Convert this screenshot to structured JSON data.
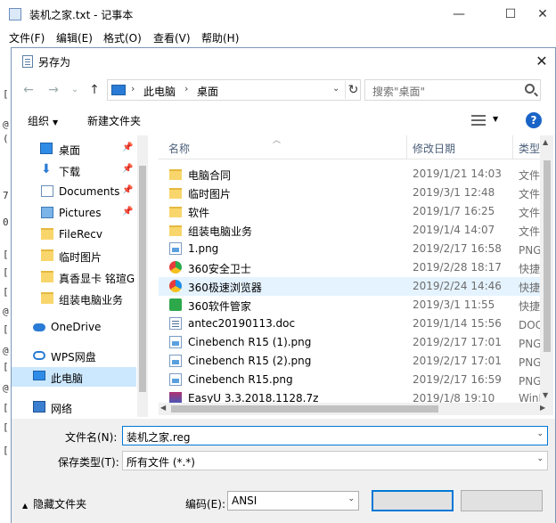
{
  "notepad": {
    "title": "装机之家.txt - 记事本",
    "controls": [
      "—",
      "☐",
      "✕"
    ],
    "menu": [
      "文件(F)",
      "编辑(E)",
      "格式(O)",
      "查看(V)",
      "帮助(H)"
    ],
    "gutter": [
      "[",
      "@",
      "(",
      "7",
      "0",
      "[",
      "[",
      "[",
      "@",
      "[",
      "@",
      "[",
      "@",
      "[",
      "[",
      "["
    ]
  },
  "dialog": {
    "title": "另存为",
    "close": "✕",
    "nav": {
      "back": "←",
      "forward": "→",
      "dropdown": "⌄",
      "up": "↑"
    },
    "address": {
      "parts": [
        "此电脑",
        "桌面"
      ],
      "separator": "›",
      "refresh": "↻"
    },
    "search": {
      "placeholder": "搜索\"桌面\""
    },
    "toolbar": {
      "organize": "组织",
      "new_folder": "新建文件夹",
      "help": "?"
    },
    "nav_pane": [
      {
        "label": "桌面",
        "icon": "desktop-icon",
        "pinned": true
      },
      {
        "label": "下载",
        "icon": "download-icon",
        "pinned": true
      },
      {
        "label": "Documents",
        "icon": "documents-icon",
        "pinned": true
      },
      {
        "label": "Pictures",
        "icon": "pictures-icon",
        "pinned": true
      },
      {
        "label": "FileRecv",
        "icon": "folder-icon",
        "pinned": false
      },
      {
        "label": "临时图片",
        "icon": "folder-icon",
        "pinned": false
      },
      {
        "label": "真香显卡 铭瑄G",
        "icon": "folder-icon",
        "pinned": false
      },
      {
        "label": "组装电脑业务",
        "icon": "folder-icon",
        "pinned": false
      },
      {
        "label": "OneDrive",
        "icon": "onedrive-icon",
        "pinned": false
      },
      {
        "label": "WPS网盘",
        "icon": "wps-cloud-icon",
        "pinned": false
      },
      {
        "label": "此电脑",
        "icon": "this-pc-icon",
        "pinned": false,
        "selected": true
      },
      {
        "label": "网络",
        "icon": "network-icon",
        "pinned": false
      }
    ],
    "columns": {
      "name": "名称",
      "date": "修改日期",
      "type": "类型"
    },
    "files": [
      {
        "name": "电脑合同",
        "date": "2019/1/21 14:03",
        "type": "文件夹",
        "icon": "folder-icon"
      },
      {
        "name": "临时图片",
        "date": "2019/3/1 12:48",
        "type": "文件夹",
        "icon": "folder-icon"
      },
      {
        "name": "软件",
        "date": "2019/1/7 16:25",
        "type": "文件夹",
        "icon": "folder-icon"
      },
      {
        "name": "组装电脑业务",
        "date": "2019/1/4 14:07",
        "type": "文件夹",
        "icon": "folder-icon"
      },
      {
        "name": "1.png",
        "date": "2019/2/17 16:58",
        "type": "PNG 文",
        "icon": "png-icon"
      },
      {
        "name": "360安全卫士",
        "date": "2019/2/28 18:17",
        "type": "快捷方",
        "icon": "360-safe-icon"
      },
      {
        "name": "360极速浏览器",
        "date": "2019/2/24 14:46",
        "type": "快捷方",
        "icon": "360-browser-icon"
      },
      {
        "name": "360软件管家",
        "date": "2019/3/1 11:55",
        "type": "快捷方",
        "icon": "360-manager-icon"
      },
      {
        "name": "antec20190113.doc",
        "date": "2019/1/14 15:56",
        "type": "DOC 文",
        "icon": "doc-icon"
      },
      {
        "name": "Cinebench R15 (1).png",
        "date": "2019/2/17 17:01",
        "type": "PNG 文",
        "icon": "png-icon"
      },
      {
        "name": "Cinebench R15 (2).png",
        "date": "2019/2/17 17:01",
        "type": "PNG 文",
        "icon": "png-icon"
      },
      {
        "name": "Cinebench R15.png",
        "date": "2019/2/17 16:59",
        "type": "PNG 文",
        "icon": "png-icon"
      },
      {
        "name": "EasyU 3.3.2018.1128.7z",
        "date": "2019/1/8 19:10",
        "type": "WinRA",
        "icon": "archive-icon"
      }
    ],
    "filename": {
      "label": "文件名(N):",
      "value": "装机之家.reg"
    },
    "filetype": {
      "label": "保存类型(T):",
      "value": "所有文件 (*.*)"
    },
    "hide_folders": "隐藏文件夹",
    "encoding": {
      "label": "编码(E):",
      "value": "ANSI"
    }
  }
}
